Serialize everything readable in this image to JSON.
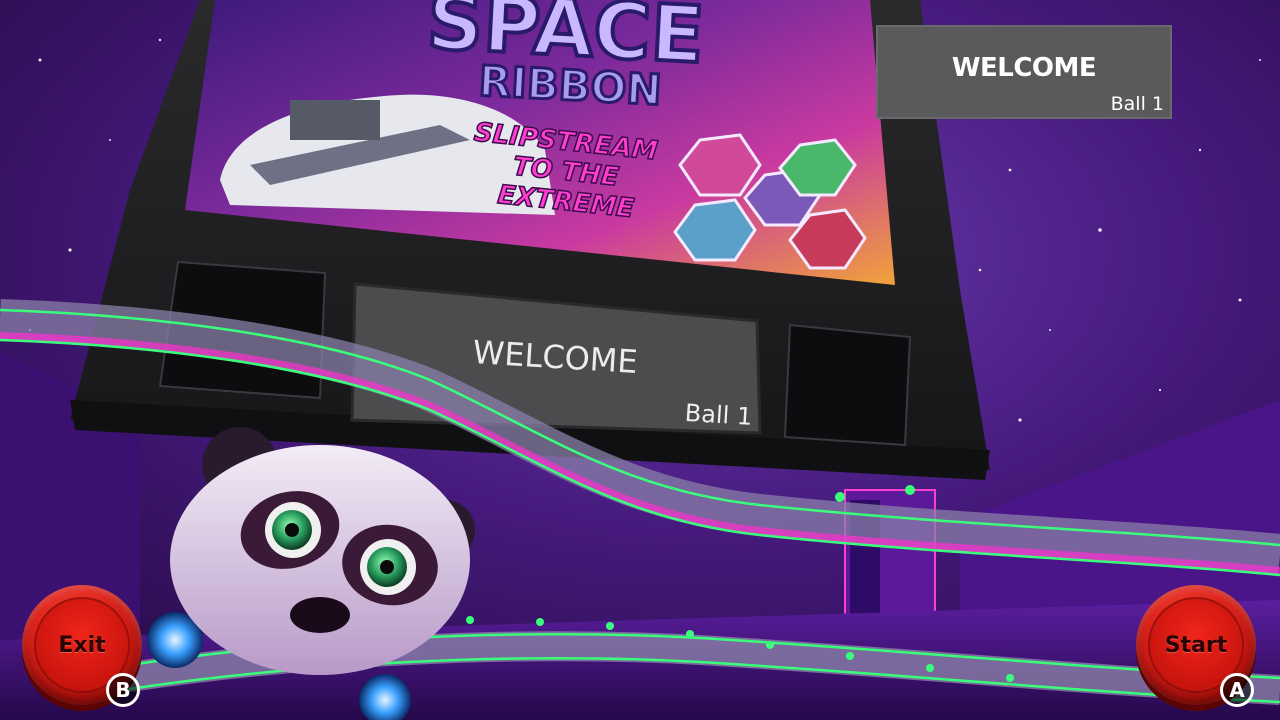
{
  "backglass": {
    "title_line1": "SPACE",
    "title_line2": "RIBBON",
    "tagline_line1": "SLIPSTREAM",
    "tagline_line2": "TO THE",
    "tagline_line3": "EXTREME"
  },
  "table_dmd": {
    "message": "WELCOME",
    "ball": "Ball 1"
  },
  "hud_dmd": {
    "message": "WELCOME",
    "ball": "Ball 1"
  },
  "controls": {
    "exit_label": "Exit",
    "exit_key": "B",
    "start_label": "Start",
    "start_key": "A"
  },
  "colors": {
    "space": "#3a1466",
    "rail_glow": "#39ff7a",
    "ribbon_pink": "#ff2fd0",
    "button_red": "#d81c12"
  }
}
